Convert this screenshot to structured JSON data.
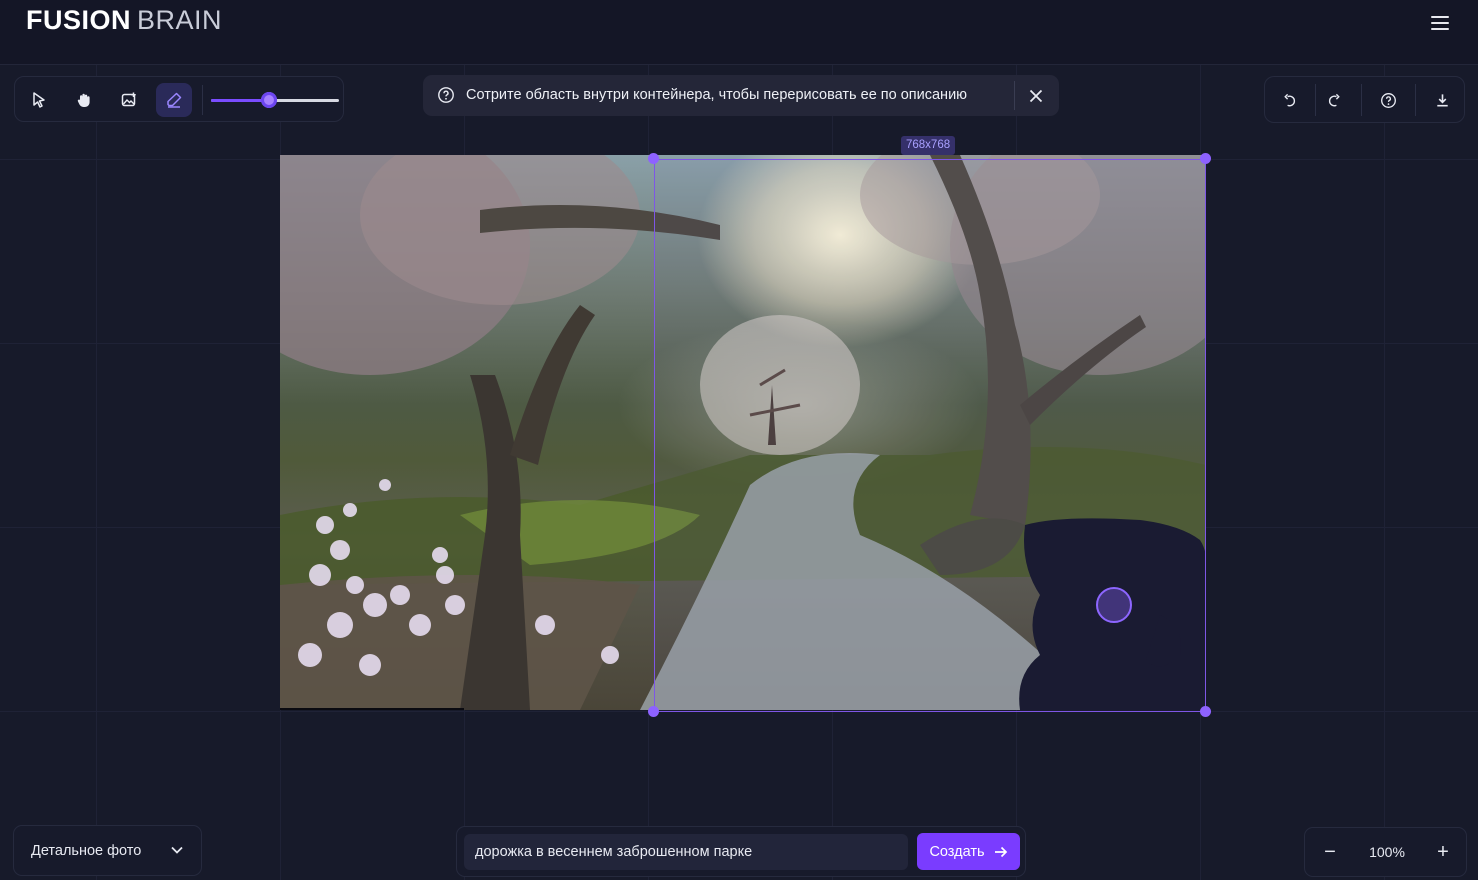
{
  "header": {
    "logo_primary": "FUSION",
    "logo_secondary": "BRAIN"
  },
  "toolbar": {
    "tools": [
      {
        "name": "select",
        "icon": "pointer-icon",
        "active": false
      },
      {
        "name": "pan",
        "icon": "hand-icon",
        "active": false
      },
      {
        "name": "upload",
        "icon": "image-add-icon",
        "active": false
      },
      {
        "name": "eraser",
        "icon": "eraser-icon",
        "active": true
      }
    ],
    "brush_size_fraction": 0.45
  },
  "hint": {
    "text": "Сотрите область внутри контейнера, чтобы перерисовать ее по описанию"
  },
  "right_toolbar": {
    "tools": [
      "undo-icon",
      "redo-icon",
      "help-icon",
      "download-icon"
    ]
  },
  "selection": {
    "size_label": "768x768"
  },
  "bottom": {
    "style_label": "Детальное фото",
    "prompt_value": "дорожка в весеннем заброшенном парке",
    "create_label": "Создать",
    "zoom_label": "100%",
    "zoom_out": "−",
    "zoom_in": "+"
  },
  "colors": {
    "accent": "#7a3cff",
    "background": "#151726",
    "panel": "#171a2b",
    "selection": "#7e56e6"
  }
}
